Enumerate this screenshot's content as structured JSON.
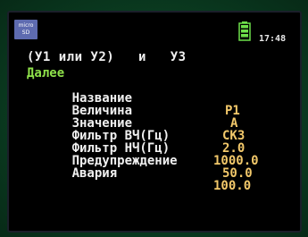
{
  "status_bar": {
    "sd_icon_line1": "micro",
    "sd_icon_line2": "SD",
    "battery_icon": "battery-full-icon",
    "time": "17:48"
  },
  "header": {
    "text": "(У1 или У2)   и   У3"
  },
  "menu": {
    "next_label": "Далее",
    "rows": [
      {
        "label": "Название",
        "value": "P1"
      },
      {
        "label": "Величина",
        "value": "A"
      },
      {
        "label": "Значение",
        "value": "СКЗ"
      },
      {
        "label": "Фильтр ВЧ(Гц)",
        "value": "2.0"
      },
      {
        "label": "Фильтр НЧ(Гц)",
        "value": "1000.0"
      },
      {
        "label": "Предупреждение",
        "value": "50.0"
      },
      {
        "label": "Авария",
        "value": "100.0"
      }
    ]
  },
  "colors": {
    "label": "#f0f0f0",
    "value": "#f2c86a",
    "next": "#8ee04a",
    "battery": "#6ee04a"
  }
}
